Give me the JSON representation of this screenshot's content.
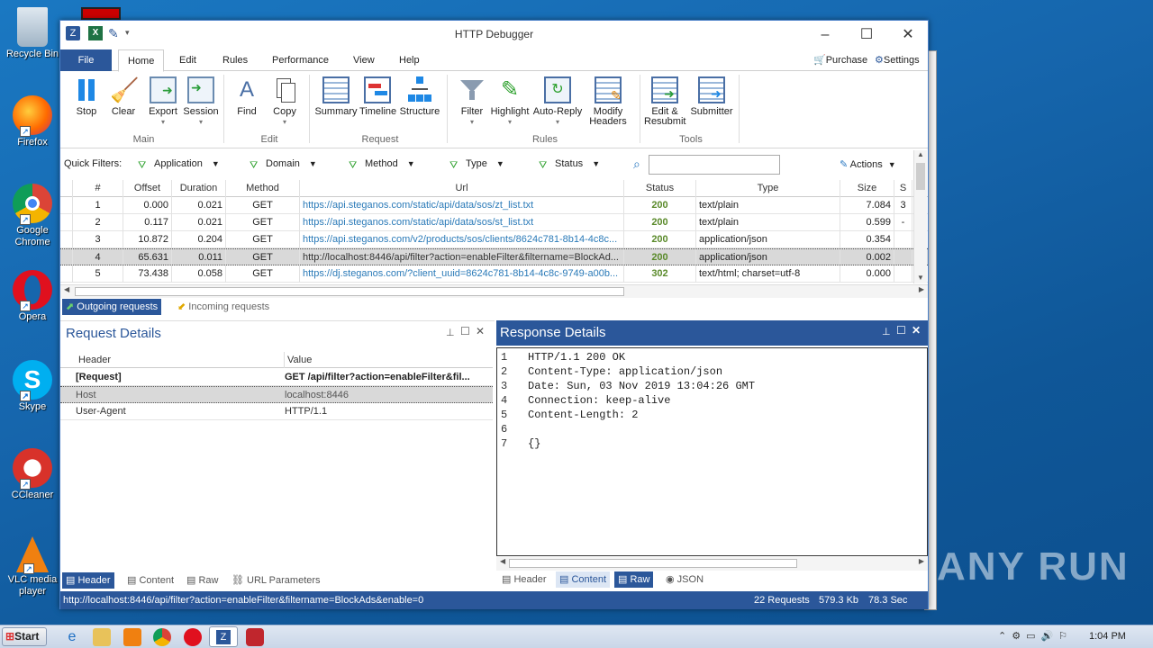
{
  "desktop": {
    "icons": [
      {
        "label": "Recycle Bin"
      },
      {
        "label": "Firefox"
      },
      {
        "label": "Google Chrome"
      },
      {
        "label": "Opera"
      },
      {
        "label": "Skype"
      },
      {
        "label": "CCleaner"
      },
      {
        "label": "VLC media player"
      }
    ],
    "watermark": "ANY RUN"
  },
  "window": {
    "title": "HTTP Debugger"
  },
  "tabs": [
    "File",
    "Home",
    "Edit",
    "Rules",
    "Performance",
    "View",
    "Help"
  ],
  "top_right": {
    "purchase": "Purchase",
    "settings": "Settings"
  },
  "ribbon": {
    "buttons": [
      "Stop",
      "Clear",
      "Export",
      "Session",
      "Find",
      "Copy",
      "Summary",
      "Timeline",
      "Structure",
      "Filter",
      "Highlight",
      "Auto-Reply",
      "Modify Headers",
      "Edit & Resubmit",
      "Submitter"
    ],
    "groups": [
      "Main",
      "Edit",
      "Request",
      "Rules",
      "Tools"
    ]
  },
  "quick_filters": {
    "label": "Quick Filters:",
    "items": [
      "Application",
      "Domain",
      "Method",
      "Type",
      "Status"
    ],
    "search_value": "",
    "actions": "Actions"
  },
  "grid": {
    "headers": [
      "#",
      "Offset",
      "Duration",
      "Method",
      "Url",
      "Status",
      "Type",
      "Size",
      "S"
    ],
    "rows": [
      [
        "1",
        "0.000",
        "0.021",
        "GET",
        "https://api.steganos.com/static/api/data/sos/zt_list.txt",
        "200",
        "text/plain",
        "7.084",
        "3"
      ],
      [
        "2",
        "0.117",
        "0.021",
        "GET",
        "https://api.steganos.com/static/api/data/sos/st_list.txt",
        "200",
        "text/plain",
        "0.599",
        "-"
      ],
      [
        "3",
        "10.872",
        "0.204",
        "GET",
        "https://api.steganos.com/v2/products/sos/clients/8624c781-8b14-4c8c...",
        "200",
        "application/json",
        "0.354",
        ""
      ],
      [
        "4",
        "65.631",
        "0.011",
        "GET",
        "http://localhost:8446/api/filter?action=enableFilter&filtername=BlockAd...",
        "200",
        "application/json",
        "0.002",
        ""
      ],
      [
        "5",
        "73.438",
        "0.058",
        "GET",
        "https://dj.steganos.com/?client_uuid=8624c781-8b14-4c8c-9749-a00b...",
        "302",
        "text/html; charset=utf-8",
        "0.000",
        ""
      ]
    ]
  },
  "req_tabs": {
    "outgoing": "Outgoing requests",
    "incoming": "Incoming requests"
  },
  "request": {
    "title": "Request Details",
    "col_header": "Header",
    "col_value": "Value",
    "rows": [
      [
        "[Request]",
        "GET /api/filter?action=enableFilter&fil..."
      ],
      [
        "Host",
        "localhost:8446"
      ],
      [
        "User-Agent",
        "HTTP/1.1"
      ]
    ],
    "tabs": [
      "Header",
      "Content",
      "Raw",
      "URL Parameters"
    ]
  },
  "response": {
    "title": "Response Details",
    "lines": [
      "HTTP/1.1 200 OK",
      "Content-Type: application/json",
      "Date: Sun, 03 Nov 2019 13:04:26 GMT",
      "Connection: keep-alive",
      "Content-Length: 2",
      "",
      "{}"
    ],
    "tabs": [
      "Header",
      "Content",
      "Raw",
      "JSON"
    ]
  },
  "status": {
    "url": "http://localhost:8446/api/filter?action=enableFilter&filtername=BlockAds&enable=0",
    "requests": "22 Requests",
    "size": "579.3 Kb",
    "time": "78.3 Sec"
  },
  "taskbar": {
    "start": "Start",
    "clock": "1:04 PM"
  }
}
